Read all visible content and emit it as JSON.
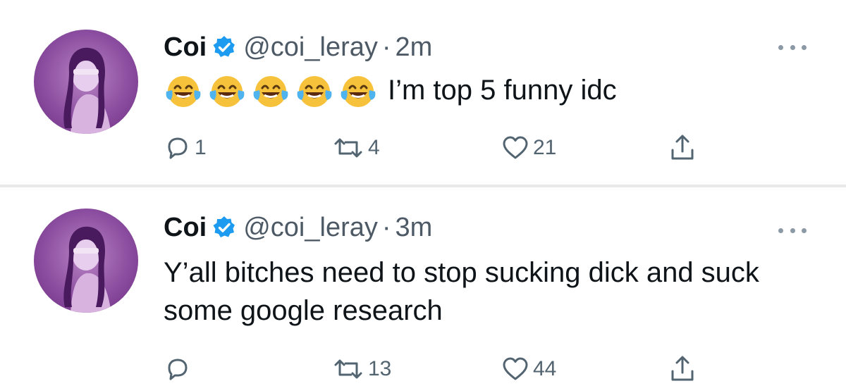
{
  "tweets": [
    {
      "name": "Coi",
      "handle": "@coi_leray",
      "separator": "·",
      "time": "2m",
      "emoji": [
        "face-with-tears-of-joy",
        "face-with-tears-of-joy",
        "face-with-tears-of-joy",
        "face-with-tears-of-joy",
        "face-with-tears-of-joy"
      ],
      "text": "I’m top 5 funny idc",
      "replies": "1",
      "retweets": "4",
      "likes": "21"
    },
    {
      "name": "Coi",
      "handle": "@coi_leray",
      "separator": "·",
      "time": "3m",
      "text": "Y’all bitches need to stop sucking dick and suck some google research",
      "replies": "",
      "retweets": "13",
      "likes": "44"
    }
  ],
  "colors": {
    "verified": "#1d9bf0",
    "avatar": "#8c4ea0",
    "secondary_text": "#536471",
    "divider": "#e7e9ea"
  },
  "icons": {
    "verified": "verified-badge-icon",
    "more": "more-options-icon",
    "reply": "reply-icon",
    "retweet": "retweet-icon",
    "like": "heart-icon",
    "share": "share-icon",
    "emoji": "face-with-tears-of-joy-icon"
  }
}
